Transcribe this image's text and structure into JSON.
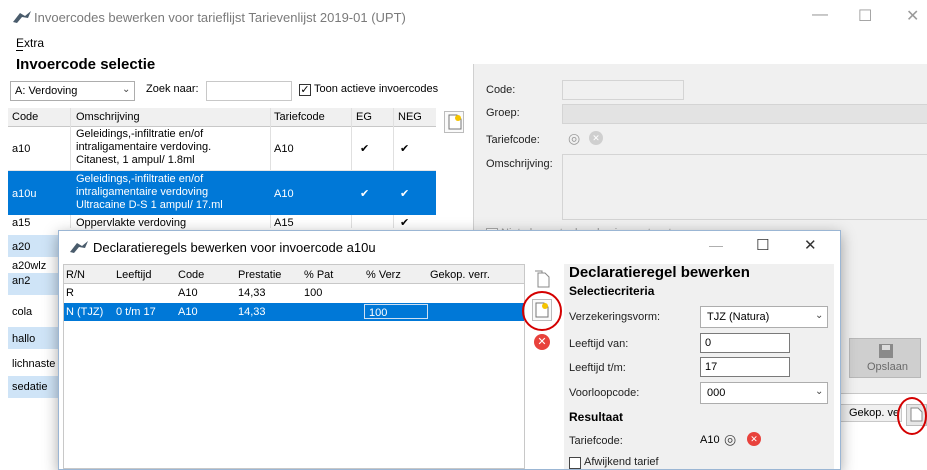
{
  "window": {
    "title": "Invoercodes bewerken voor tarieflijst Tarievenlijst 2019-01 (UPT)",
    "minimize": "—",
    "maximize": "☐",
    "close": "✕"
  },
  "menu": {
    "extra": "Extra"
  },
  "selection": {
    "heading": "Invoercode selectie",
    "filter_value": "A: Verdoving",
    "search_label": "Zoek naar:",
    "search_value": "",
    "active_checkbox_label": "Toon actieve invoercodes",
    "active_checked": true
  },
  "codes_table": {
    "headers": [
      "Code",
      "Omschrijving",
      "Tariefcode",
      "EG",
      "NEG"
    ],
    "rows": [
      {
        "code": "a10",
        "desc": [
          "Geleidings,-infiltratie en/of",
          "intraligamentaire verdoving.",
          "Citanest, 1 ampul/ 1.8ml"
        ],
        "tariff": "A10",
        "eg": "✔",
        "neg": "✔",
        "selected": false
      },
      {
        "code": "a10u",
        "desc": [
          "Geleidings,-infiltratie en/of",
          "intraligamentaire verdoving",
          "Ultracaine D-S 1 ampul/ 17.ml"
        ],
        "tariff": "A10",
        "eg": "✔",
        "neg": "✔",
        "selected": true
      },
      {
        "code": "a15",
        "desc": [
          "Oppervlakte verdoving"
        ],
        "tariff": "A15",
        "eg": "",
        "neg": "✔",
        "selected": false
      }
    ],
    "left_codes": [
      "a20",
      "a20wlz",
      "an2",
      "cola",
      "hallo",
      "lichnaste",
      "sedatie"
    ]
  },
  "detail": {
    "code_label": "Code:",
    "group_label": "Groep:",
    "tariff_label": "Tariefcode:",
    "desc_label": "Omschrijving:",
    "partial_checkbox_label": "Niet elementgebonden invoer toestaan",
    "save_label": "Opslaan",
    "gekop_label": "Gekop. ve"
  },
  "dialog": {
    "title": "Declaratieregels bewerken voor invoercode a10u",
    "headers": [
      "R/N",
      "Leeftijd",
      "Code",
      "Prestatie",
      "% Pat",
      "% Verz",
      "Gekop. verr."
    ],
    "rows": [
      {
        "rn": "R",
        "age": "",
        "code": "A10",
        "prestatie": "14,33",
        "pat": "100",
        "verz": "",
        "gekop": "",
        "selected": false
      },
      {
        "rn": "N (TJZ)",
        "age": "0 t/m 17",
        "code": "A10",
        "prestatie": "14,33",
        "pat": "",
        "verz": "100",
        "gekop": "",
        "selected": true
      }
    ],
    "edit": {
      "heading": "Declaratieregel bewerken",
      "criteria_heading": "Selectiecriteria",
      "insurance_label": "Verzekeringsvorm:",
      "insurance_value": "TJZ (Natura)",
      "age_from_label": "Leeftijd van:",
      "age_from_value": "0",
      "age_to_label": "Leeftijd t/m:",
      "age_to_value": "17",
      "prefix_label": "Voorloopcode:",
      "prefix_value": "000",
      "result_heading": "Resultaat",
      "tariff_label": "Tariefcode:",
      "tariff_value": "A10",
      "deviating_label": "Afwijkend tarief"
    }
  },
  "colors": {
    "selection": "#0078d7",
    "highlight_circle": "#d40000",
    "panel": "#f0f0f0"
  }
}
